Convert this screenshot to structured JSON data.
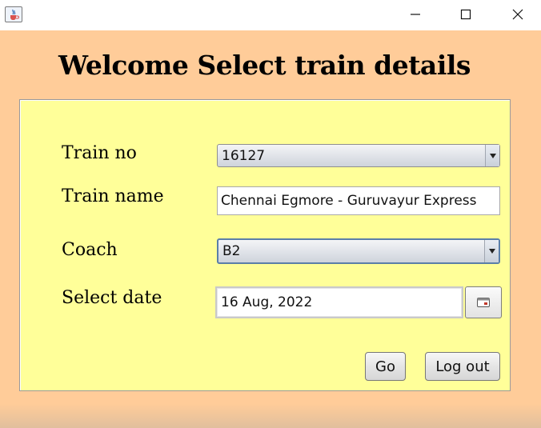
{
  "window": {
    "icon": "java-cup-icon",
    "controls": [
      "minimize-icon",
      "maximize-icon",
      "close-icon"
    ]
  },
  "heading": "Welcome Select train details",
  "form": {
    "train_no": {
      "label": "Train no",
      "value": "16127"
    },
    "train_name": {
      "label": "Train name",
      "value": "Chennai Egmore - Guruvayur Express"
    },
    "coach": {
      "label": "Coach",
      "value": "B2"
    },
    "date": {
      "label": "Select date",
      "value": "16 Aug, 2022",
      "picker_icon": "calendar-icon"
    }
  },
  "buttons": {
    "go": "Go",
    "logout": "Log out"
  },
  "colors": {
    "frame_background": "#ffcc99",
    "panel_background": "#ffff99"
  }
}
